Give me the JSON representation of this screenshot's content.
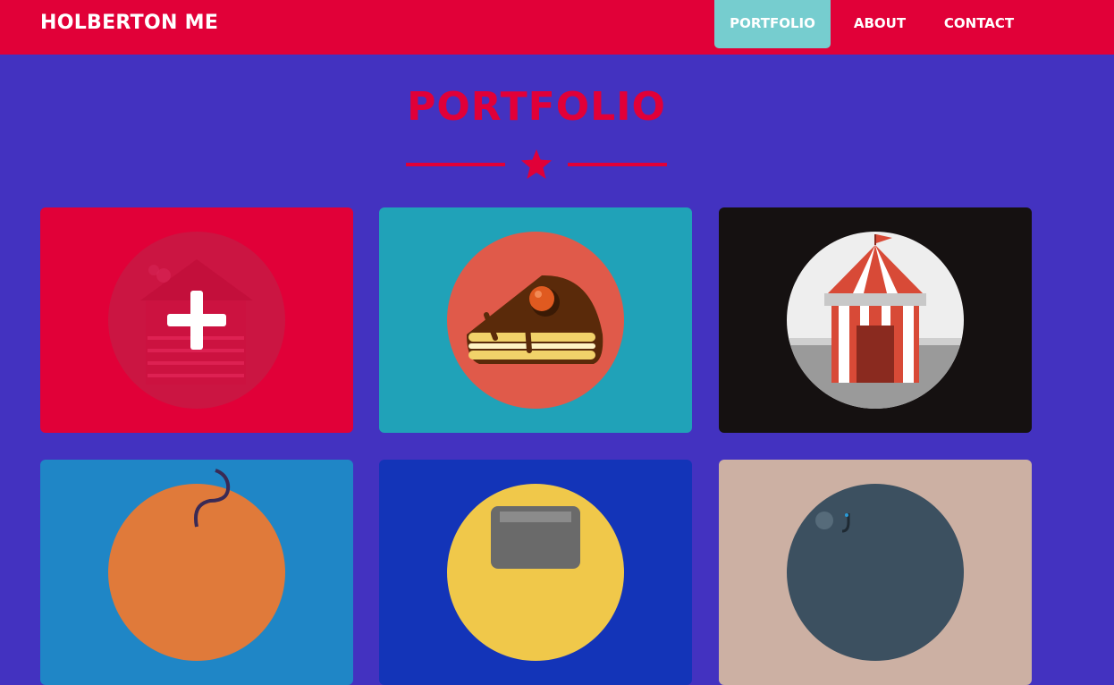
{
  "navbar": {
    "brand": "HOLBERTON ME",
    "items": [
      {
        "label": "PORTFOLIO",
        "active": true
      },
      {
        "label": "ABOUT",
        "active": false
      },
      {
        "label": "CONTACT",
        "active": false
      }
    ]
  },
  "portfolio": {
    "title": "PORTFOLIO",
    "divider_icon": "star-icon",
    "cards": [
      {
        "icon": "cabin-icon",
        "background": "#e10038",
        "hover_icon": "plus-icon"
      },
      {
        "icon": "cake-icon",
        "background": "#20a2b8"
      },
      {
        "icon": "circus-tent-icon",
        "background": "#151111"
      },
      {
        "icon": "game-controller-icon",
        "background": "#1f86c6"
      },
      {
        "icon": "safe-icon",
        "background": "#1334b8"
      },
      {
        "icon": "submarine-icon",
        "background": "#ccb0a3"
      }
    ]
  },
  "colors": {
    "page_background": "#4332c0",
    "navbar_background": "#e10038",
    "active_nav": "#76cdcf",
    "accent": "#e10038"
  }
}
